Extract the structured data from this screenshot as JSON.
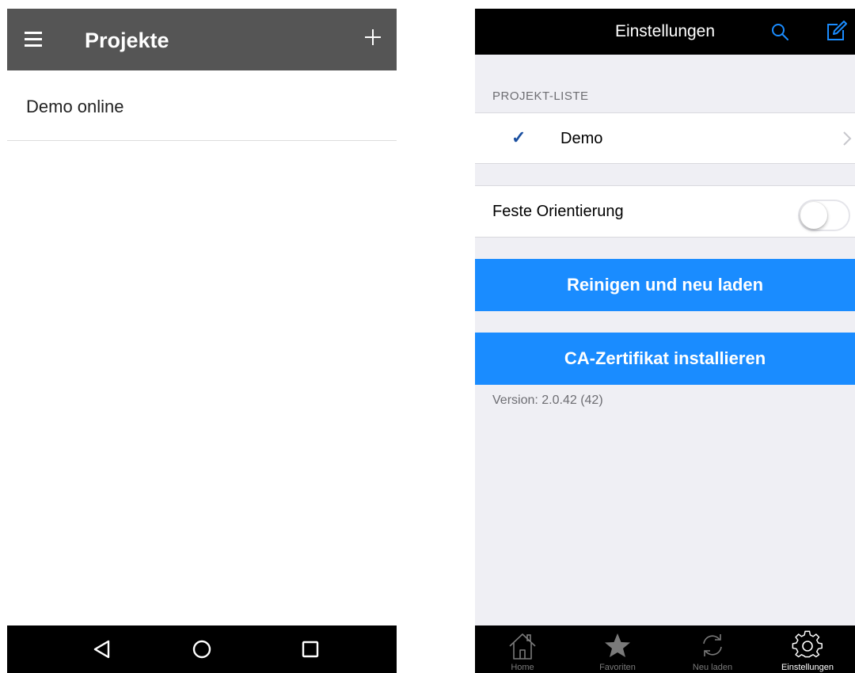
{
  "android": {
    "toolbar": {
      "title": "Projekte",
      "menu_icon": "hamburger-menu-icon",
      "add_icon": "plus-icon"
    },
    "list": [
      {
        "label": "Demo online"
      }
    ],
    "navbar": {
      "back_icon": "triangle-back-icon",
      "home_icon": "circle-home-icon",
      "recents_icon": "square-recents-icon"
    }
  },
  "ios": {
    "navbar": {
      "title": "Einstellungen",
      "search_icon": "search-icon",
      "edit_icon": "compose-edit-icon",
      "accent_color": "#1a8cff"
    },
    "project_section": {
      "header": "PROJEKT-LISTE",
      "items": [
        {
          "label": "Demo",
          "checkmark": "✓",
          "selected": true
        }
      ]
    },
    "orientation": {
      "label": "Feste Orientierung",
      "enabled": false
    },
    "buttons": {
      "reload": "Reinigen und neu laden",
      "certificate": "CA-Zertifikat installieren",
      "color": "#1a8cff"
    },
    "version_text": "Version: 2.0.42 (42)",
    "tabbar": {
      "tabs": [
        {
          "label": "Home",
          "icon": "home-icon",
          "active": false
        },
        {
          "label": "Favoriten",
          "icon": "star-icon",
          "active": false
        },
        {
          "label": "Neu laden",
          "icon": "reload-icon",
          "active": false
        },
        {
          "label": "Einstellungen",
          "icon": "gear-icon",
          "active": true
        }
      ]
    }
  }
}
